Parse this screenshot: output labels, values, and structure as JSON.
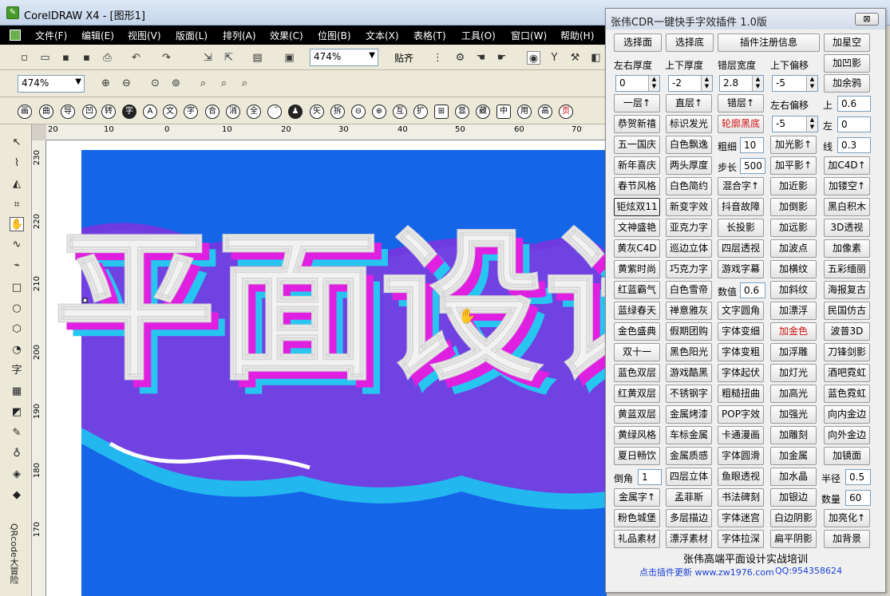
{
  "window": {
    "title": "CorelDRAW X4 - [图形1]"
  },
  "menu": [
    "文件(F)",
    "编辑(E)",
    "视图(V)",
    "版面(L)",
    "排列(A)",
    "效果(C)",
    "位图(B)",
    "文本(X)",
    "表格(T)",
    "工具(O)",
    "窗口(W)",
    "帮助(H)"
  ],
  "toolbar": {
    "zoom1": "474%",
    "snap_label": "贴齐",
    "zoom2": "474%"
  },
  "glyph_row": [
    "画",
    "曲",
    "导",
    "凹",
    "转",
    "字",
    "A",
    "文",
    "字",
    "合",
    "消",
    "全",
    "ଁ",
    "♟",
    "矢",
    "拆",
    "⊖",
    "⊕",
    "互",
    "扩",
    "⊞",
    "显",
    "藏",
    "中",
    "用",
    "高",
    "页"
  ],
  "ruler_h": [
    "20",
    "10",
    "0",
    "10",
    "20",
    "30",
    "40",
    "50",
    "60",
    "70"
  ],
  "ruler_v": [
    "230",
    "220",
    "210",
    "200",
    "190",
    "180",
    "170"
  ],
  "toolbox": {
    "qr_label": "QRcode大冒险"
  },
  "artwork": {
    "text": "平面设计",
    "bg_color": "#1565e8",
    "face_color": "#f2f2f2",
    "shade1": "#e020e0",
    "shade2": "#26c6f0"
  },
  "panel": {
    "title": "张伟CDR一键快手字效插件  1.0版",
    "close_label": "⊠",
    "row1": [
      "选择面",
      "选择底",
      "插件注册信息",
      "加星空"
    ],
    "row2_labels": [
      "左右厚度",
      "上下厚度",
      "错层宽度",
      "上下偏移"
    ],
    "row2_btn": "加凹影",
    "row3_values": [
      "0",
      "-2",
      "2.8",
      "-5"
    ],
    "row3_btn": "加余鸦",
    "row4": [
      "一层↑",
      "直层↑",
      "错层↑"
    ],
    "row4_label": "左右偏移",
    "row4_label2": "上",
    "row4_value": "0.6",
    "row5": [
      "恭贺新禧",
      "标识发光",
      "轮廓黑底"
    ],
    "row5_value": "-5",
    "row5_label2": "左",
    "row5_value2": "0",
    "row6": [
      "五一国庆",
      "白色飘逸"
    ],
    "row6_label": "粗细",
    "row6_value": "10",
    "row6_btn": "加光影↑",
    "row6_label2": "线",
    "row6_value2": "0.3",
    "row7": [
      "新年喜庆",
      "两头厚度"
    ],
    "row7_label": "步长",
    "row7_value": "500",
    "row7_btns": [
      "加平影↑",
      "加C4D↑"
    ],
    "grid_rows": [
      [
        "春节风格",
        "白色简约",
        "混合字↑",
        "加近影",
        "加镂空↑"
      ],
      [
        "钜炫双11",
        "新变字效",
        "抖音故障",
        "加倒影",
        "黑白积木"
      ],
      [
        "文神盛艳",
        "亚克力字",
        "长投影",
        "加远影",
        "3D透视"
      ],
      [
        "黄灰C4D",
        "巡边立体",
        "四层透视",
        "加波点",
        "加像素"
      ],
      [
        "黄紫时尚",
        "巧克力字",
        "游戏字幕",
        "加横纹",
        "五彩缅丽"
      ]
    ],
    "row13": [
      "红蓝霸气",
      "白色雪帝"
    ],
    "row13_label": "数值",
    "row13_value": "0.6",
    "row13_btns": [
      "加斜纹",
      "海报复古"
    ],
    "grid_rows2": [
      [
        "蓝绿春天",
        "禅意雅灰",
        "文字圆角",
        "加漂浮",
        "民国仿古"
      ],
      [
        "金色盛典",
        "假期团购",
        "字体变细",
        "加金色",
        "波普3D"
      ],
      [
        "双十一",
        "黑色阳光",
        "字体变粗",
        "加浮雕",
        "刀锋剑影"
      ],
      [
        "蓝色双层",
        "游戏酷黑",
        "字体起伏",
        "加灯光",
        "酒吧霓虹"
      ],
      [
        "红黄双层",
        "不锈钢字",
        "粗糙扭曲",
        "加高光",
        "蓝色霓虹"
      ],
      [
        "黄蓝双层",
        "金属烤漆",
        "POP字效",
        "加强光",
        "向内金边"
      ],
      [
        "黄绿风格",
        "车标金属",
        "卡通漫画",
        "加雕刻",
        "向外金边"
      ],
      [
        "夏日畅饮",
        "金属质感",
        "字体圆滑",
        "加金属",
        "加镜面"
      ]
    ],
    "row22_label": "倒角",
    "row22_value": "1",
    "row22_btns": [
      "四层立体",
      "鱼眼透视",
      "加水晶"
    ],
    "row22_label2": "半径",
    "row22_value2": "0.5",
    "row23": [
      "金属字↑",
      "孟菲斯",
      "书法碑刻",
      "加银边"
    ],
    "row23_label": "数量",
    "row23_value": "60",
    "grid_rows3": [
      [
        "粉色城堡",
        "多层描边",
        "字体迷宫",
        "白边阴影",
        "加亮化↑"
      ],
      [
        "礼品素材",
        "漂浮素材",
        "字体拉深",
        "扁平阴影",
        "加背景"
      ]
    ],
    "footer_title": "张伟高端平面设计实战培训",
    "footer_link": "点击插件更新 www.zw1976.com",
    "footer_qq": "QQ:954358624"
  }
}
